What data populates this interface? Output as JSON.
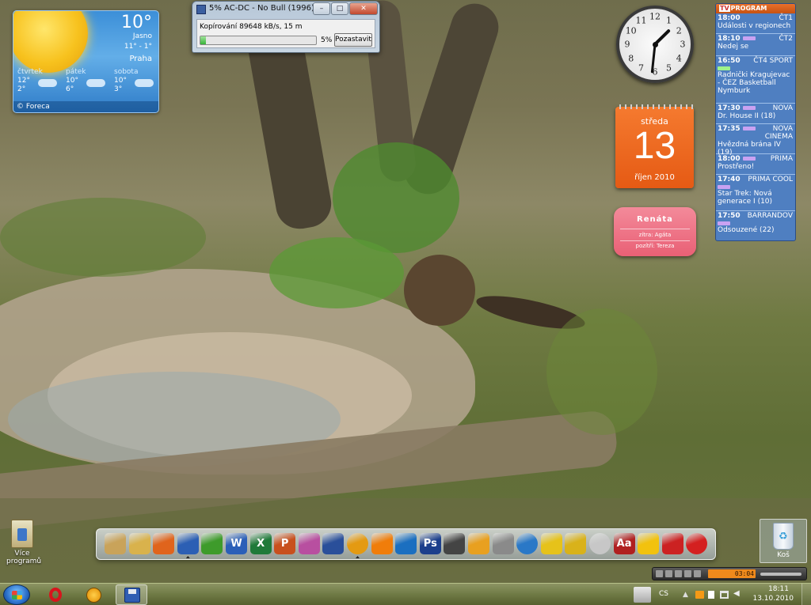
{
  "weather": {
    "temp": "10°",
    "condition": "Jasno",
    "range": "11° - 1°",
    "city": "Praha",
    "provider": "© Foreca",
    "days": [
      {
        "name": "čtvrtek",
        "hi": "12°",
        "lo": "2°"
      },
      {
        "name": "pátek",
        "hi": "10°",
        "lo": "6°"
      },
      {
        "name": "sobota",
        "hi": "10°",
        "lo": "3°"
      }
    ]
  },
  "copy_dialog": {
    "title": "5% AC-DC - No Bull (1996) ...",
    "status": "Kopírování 89648 kB/s, 15 m",
    "percent": "5%",
    "progress": 0.05,
    "pause_label": "Pozastavit",
    "minimize": "–",
    "maximize": "□",
    "close": "✕"
  },
  "clock": {
    "numbers": [
      "12",
      "1",
      "2",
      "3",
      "4",
      "5",
      "6",
      "7",
      "8",
      "9",
      "10",
      "11"
    ],
    "hour": 1,
    "minute": 31
  },
  "calendar": {
    "weekday": "středa",
    "day": "13",
    "month": "říjen 2010"
  },
  "nameday": {
    "today": "Renáta",
    "tomorrow": "zítra: Agáta",
    "after": "pozítří: Tereza"
  },
  "tv": {
    "header_box": "TV",
    "header": "PROGRAM",
    "rows": [
      {
        "time": "18:00",
        "channel": "ČT1",
        "show": "Události v regionech",
        "tag": false
      },
      {
        "time": "18:10",
        "channel": "ČT2",
        "show": "Nedej se",
        "tag": true
      },
      {
        "time": "16:50",
        "channel": "ČT4 SPORT",
        "show": "Radnički Kragujevac - ČEZ Basketball Nymburk",
        "tag": true
      },
      {
        "time": "17:30",
        "channel": "NOVA",
        "show": "Dr. House II (18)",
        "tag": true
      },
      {
        "time": "17:35",
        "channel": "NOVA CINEMA",
        "show": "Hvězdná brána IV (19)",
        "tag": true
      },
      {
        "time": "18:00",
        "channel": "PRIMA",
        "show": "Prostřeno!",
        "tag": true
      },
      {
        "time": "17:40",
        "channel": "PRIMA COOL",
        "show": "Star Trek: Nová generace I (10)",
        "tag": true
      },
      {
        "time": "17:50",
        "channel": "BARRANDOV",
        "show": "Odsouzené (22)",
        "tag": true
      }
    ]
  },
  "desktop": {
    "programs_label": "Více programů",
    "bin_label": "Koš"
  },
  "dock_icons": [
    "user-folder-icon",
    "folder-icon",
    "firefox-icon",
    "save-disk-icon",
    "tree-icon",
    "word-icon",
    "excel-icon",
    "powerpoint-icon",
    "paint-icon",
    "headphones-icon",
    "aimp-icon",
    "vlc-icon",
    "screen-icon",
    "photoshop-icon",
    "film-icon",
    "donut-icon",
    "magnifier-icon",
    "globe-icon",
    "plug-icon",
    "quiz-icon",
    "wikipedia-icon",
    "dictionary-icon",
    "honeycomb-icon",
    "x-tool-icon",
    "power-icon"
  ],
  "dock_labels": {
    "word-icon": "W",
    "excel-icon": "X",
    "powerpoint-icon": "P",
    "photoshop-icon": "Ps",
    "dictionary-icon": "Aa"
  },
  "media": {
    "time": "03:04"
  },
  "taskbar": {
    "lang": "CS",
    "time": "18:11",
    "date": "13.10.2010"
  }
}
